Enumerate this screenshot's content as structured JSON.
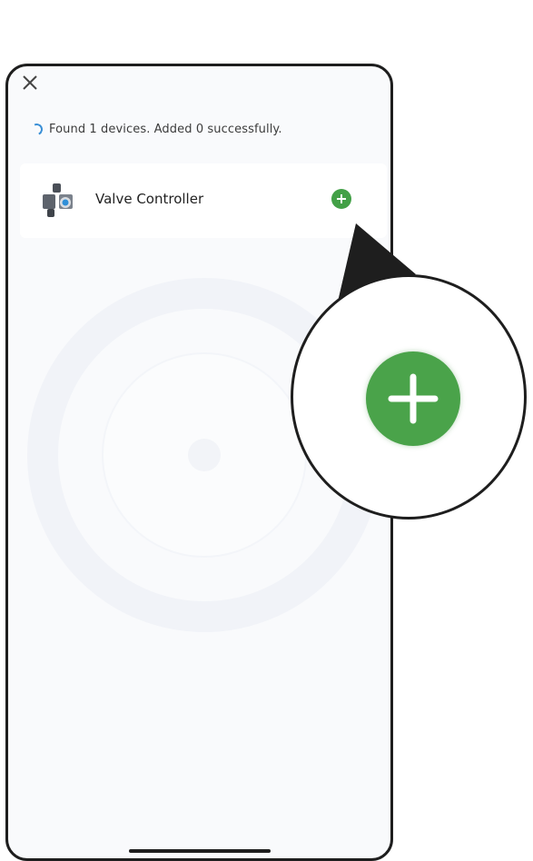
{
  "header": {
    "close_icon": "close-icon"
  },
  "status": {
    "text": "Found 1 devices. Added 0 successfully.",
    "icon": "spinner-icon",
    "color": "#3a8fd6"
  },
  "devices": [
    {
      "name": "Valve Controller",
      "icon": "valve-icon",
      "action_icon": "plus-icon",
      "action_color": "#43a047"
    }
  ],
  "callout": {
    "icon": "plus-icon",
    "color": "#4aa34a"
  }
}
